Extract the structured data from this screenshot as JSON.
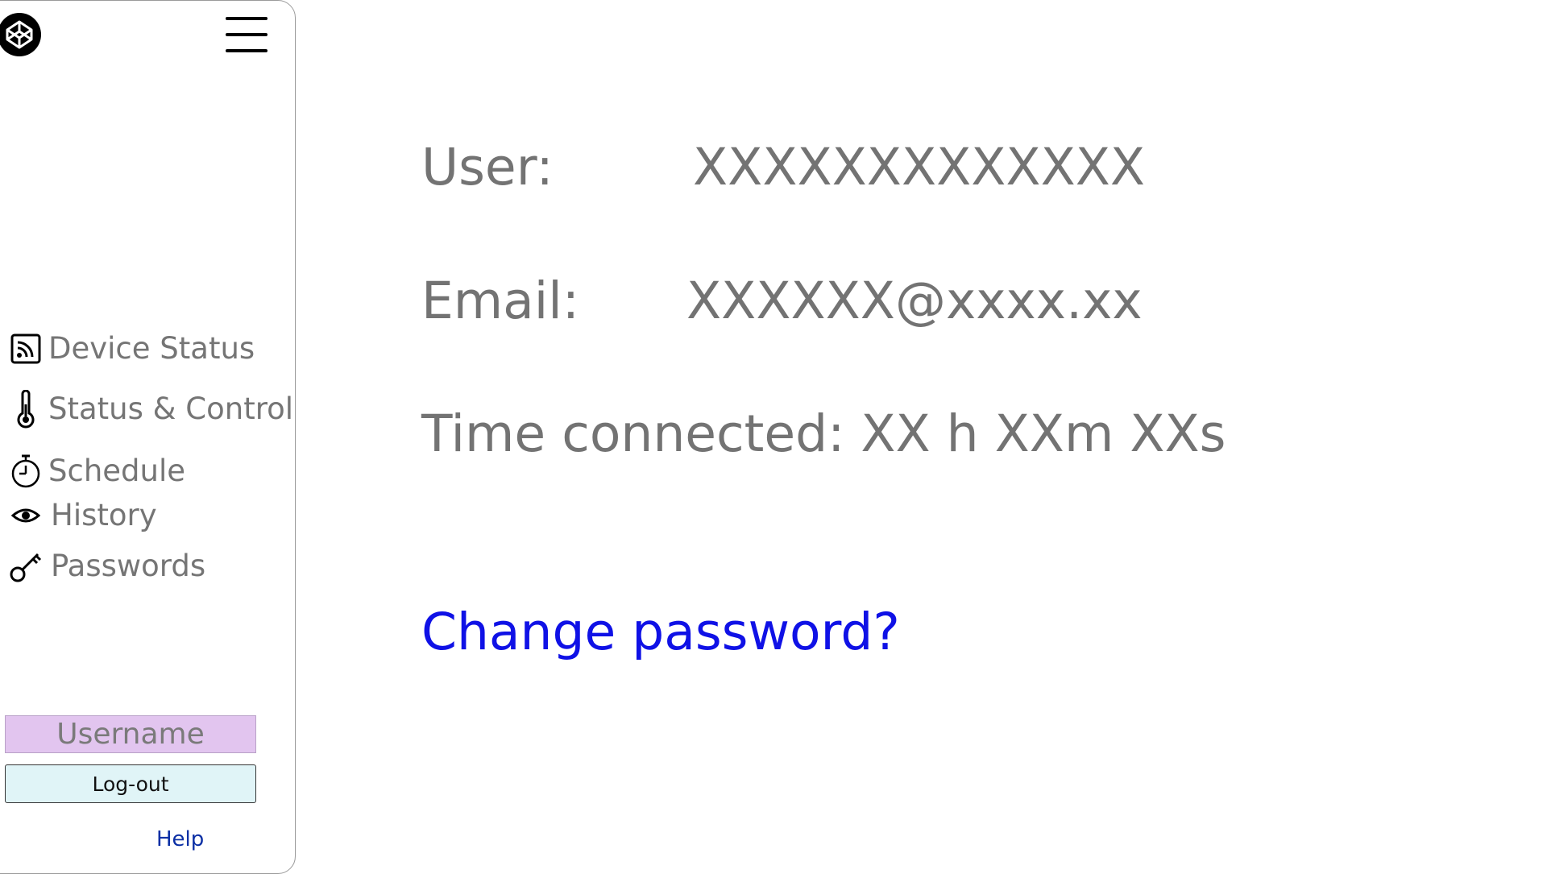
{
  "sidebar": {
    "items": [
      {
        "label": "Device Status",
        "icon": "rss-icon"
      },
      {
        "label": "Status & Control",
        "icon": "thermometer-icon"
      },
      {
        "label": "Schedule",
        "icon": "stopwatch-icon"
      },
      {
        "label": "History",
        "icon": "eye-icon"
      },
      {
        "label": "Passwords",
        "icon": "key-icon"
      }
    ],
    "username": "Username",
    "logout_label": "Log-out",
    "help_label": "Help"
  },
  "main": {
    "user_label": "User:",
    "user_value": "XXXXXXXXXXXXX",
    "email_label": "Email:",
    "email_value": "XXXXXX@xxxx.xx",
    "time_connected": "Time connected: XX h XXm XXs",
    "change_password_label": "Change password?"
  },
  "colors": {
    "text_gray": "#737373",
    "link_blue": "#0f11e6",
    "username_bg": "#e2c5ef",
    "logout_bg": "#e0f4f7",
    "help_blue": "#0b2fa5"
  }
}
